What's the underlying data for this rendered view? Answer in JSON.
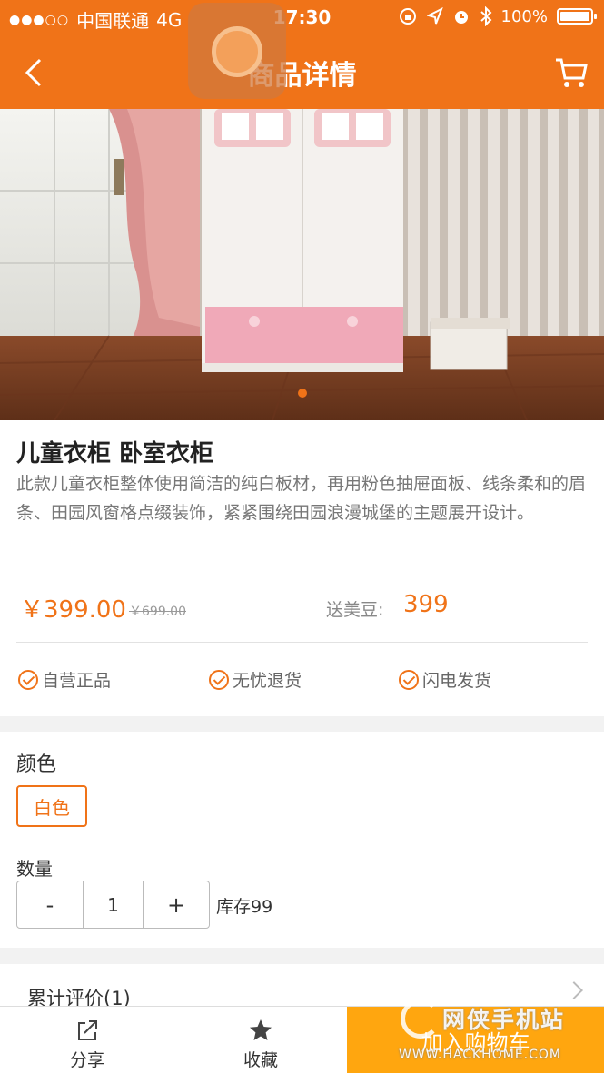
{
  "status_bar": {
    "carrier": "中国联通",
    "network": "4G",
    "time": "17:30",
    "battery": "100%",
    "battery_level": 1.0,
    "signal_icon": "signal-dots-icon",
    "icons": [
      "lock-rotation-icon",
      "location-arrow-icon",
      "alarm-icon",
      "bluetooth-icon",
      "battery-icon"
    ]
  },
  "nav": {
    "title": "商品详情",
    "back_icon": "chevron-left-icon",
    "cart_icon": "cart-icon"
  },
  "gallery": {
    "image_description_icon": "product-photo",
    "page_count": 1,
    "active_page": 1
  },
  "product": {
    "title": "儿童衣柜 卧室衣柜",
    "description": "此款儿童衣柜整体使用简洁的纯白板材，再用粉色抽屉面板、线条柔和的眉条、田园风窗格点缀装饰，紧紧围绕田园浪漫城堡的主题展开设计。",
    "price": "￥399.00",
    "original_price": "￥699.00",
    "bean_label": "送美豆:",
    "bean_value": "399",
    "assurances": [
      "自营正品",
      "无忧退货",
      "闪电发货"
    ]
  },
  "options": {
    "color_label": "颜色",
    "color_selected": "白色",
    "quantity_label": "数量",
    "minus": "-",
    "quantity": "1",
    "plus": "+",
    "stock": "库存99"
  },
  "reviews": {
    "label": "累计评价(1)"
  },
  "bottom_bar": {
    "share_label": "分享",
    "favorite_label": "收藏",
    "add_to_cart_label": "加入购物车"
  },
  "watermark": {
    "line1": "网侠手机站",
    "line2": "WWW.HACKHOME.COM"
  },
  "colors": {
    "accent": "#f07318",
    "cart_button": "#ffa60f"
  }
}
